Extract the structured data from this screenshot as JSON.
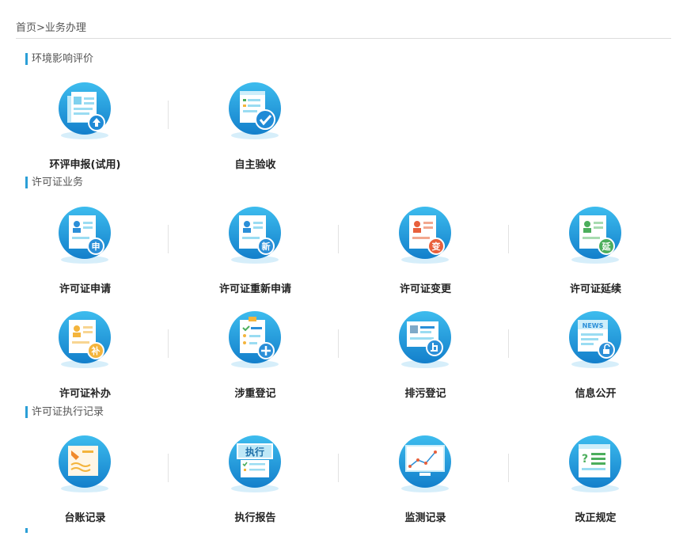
{
  "breadcrumb": {
    "home": "首页",
    "separator": ">",
    "current": "业务办理"
  },
  "sections": [
    {
      "title": "环境影响评价",
      "items": [
        {
          "label": "环评申报(试用)",
          "icon": "document-upload-icon"
        },
        {
          "label": "自主验收",
          "icon": "checklist-approved-icon"
        }
      ]
    },
    {
      "title": "许可证业务",
      "items": [
        {
          "label": "许可证申请",
          "icon": "license-apply-icon",
          "badge": "申",
          "badge_color": "#2b8fd8"
        },
        {
          "label": "许可证重新申请",
          "icon": "license-reapply-icon",
          "badge": "新",
          "badge_color": "#2b8fd8"
        },
        {
          "label": "许可证变更",
          "icon": "license-change-icon",
          "badge": "变",
          "badge_color": "#e8603c"
        },
        {
          "label": "许可证延续",
          "icon": "license-extend-icon",
          "badge": "延",
          "badge_color": "#4cae5c"
        },
        {
          "label": "许可证补办",
          "icon": "license-reissue-icon",
          "badge": "补",
          "badge_color": "#f4b43c"
        },
        {
          "label": "涉重登记",
          "icon": "clipboard-add-icon"
        },
        {
          "label": "排污登记",
          "icon": "pollution-register-icon"
        },
        {
          "label": "信息公开",
          "icon": "news-unlock-icon",
          "news_text": "NEWS"
        }
      ]
    },
    {
      "title": "许可证执行记录",
      "items": [
        {
          "label": "台账记录",
          "icon": "ledger-record-icon"
        },
        {
          "label": "执行报告",
          "icon": "execution-report-icon",
          "board_text": "执行"
        },
        {
          "label": "监测记录",
          "icon": "monitor-chart-icon"
        },
        {
          "label": "改正规定",
          "icon": "correction-doc-icon"
        }
      ]
    }
  ],
  "colors": {
    "accent": "#2b9fd6",
    "circle_top": "#37b6ea",
    "circle_bottom": "#1482cc"
  }
}
